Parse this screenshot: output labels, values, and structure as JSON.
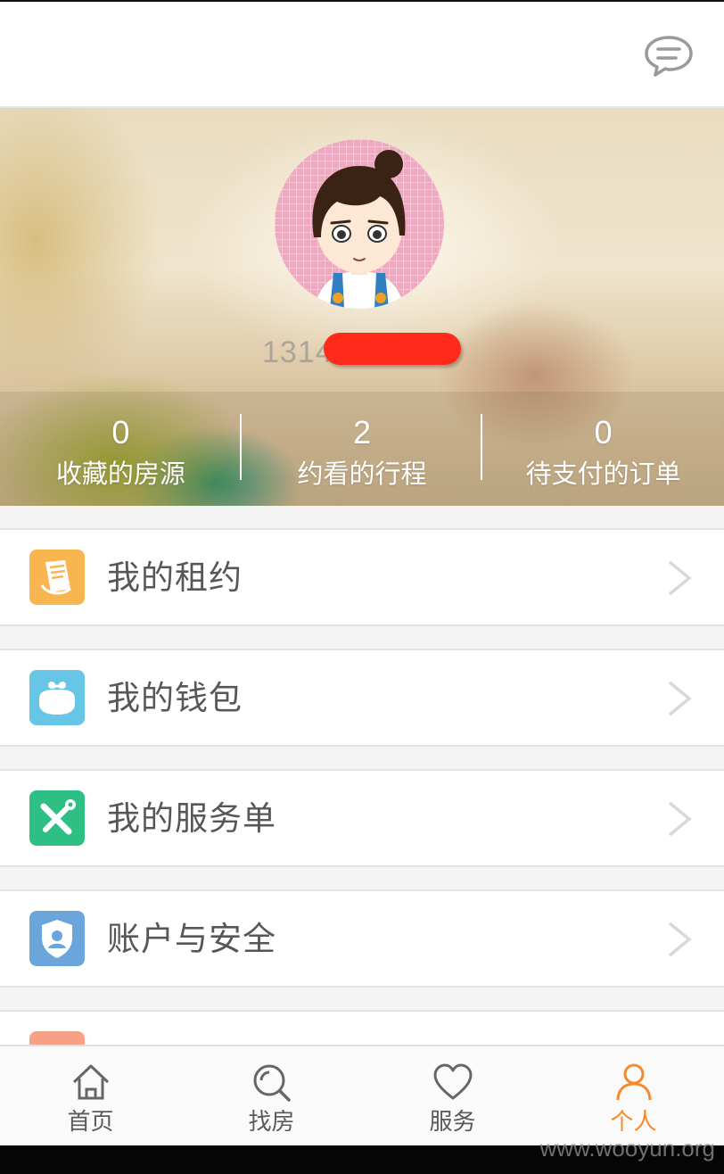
{
  "profile": {
    "username_visible": "1314"
  },
  "stats": [
    {
      "value": "0",
      "label": "收藏的房源"
    },
    {
      "value": "2",
      "label": "约看的行程"
    },
    {
      "value": "0",
      "label": "待支付的订单"
    }
  ],
  "menu": [
    {
      "label": "我的租约",
      "icon": "lease-document-icon",
      "color": "#f9b54f"
    },
    {
      "label": "我的钱包",
      "icon": "wallet-purse-icon",
      "color": "#67c6e6"
    },
    {
      "label": "我的服务单",
      "icon": "tools-wrench-icon",
      "color": "#2dbf83"
    },
    {
      "label": "账户与安全",
      "icon": "shield-user-icon",
      "color": "#6aa6dc"
    }
  ],
  "nav": [
    {
      "label": "首页",
      "icon": "home-icon"
    },
    {
      "label": "找房",
      "icon": "search-icon"
    },
    {
      "label": "服务",
      "icon": "heart-icon"
    },
    {
      "label": "个人",
      "icon": "person-icon",
      "active": true
    }
  ],
  "colors": {
    "accent": "#f58a2c",
    "redaction": "#ff2a1a"
  },
  "watermark": "www.wooyun.org"
}
